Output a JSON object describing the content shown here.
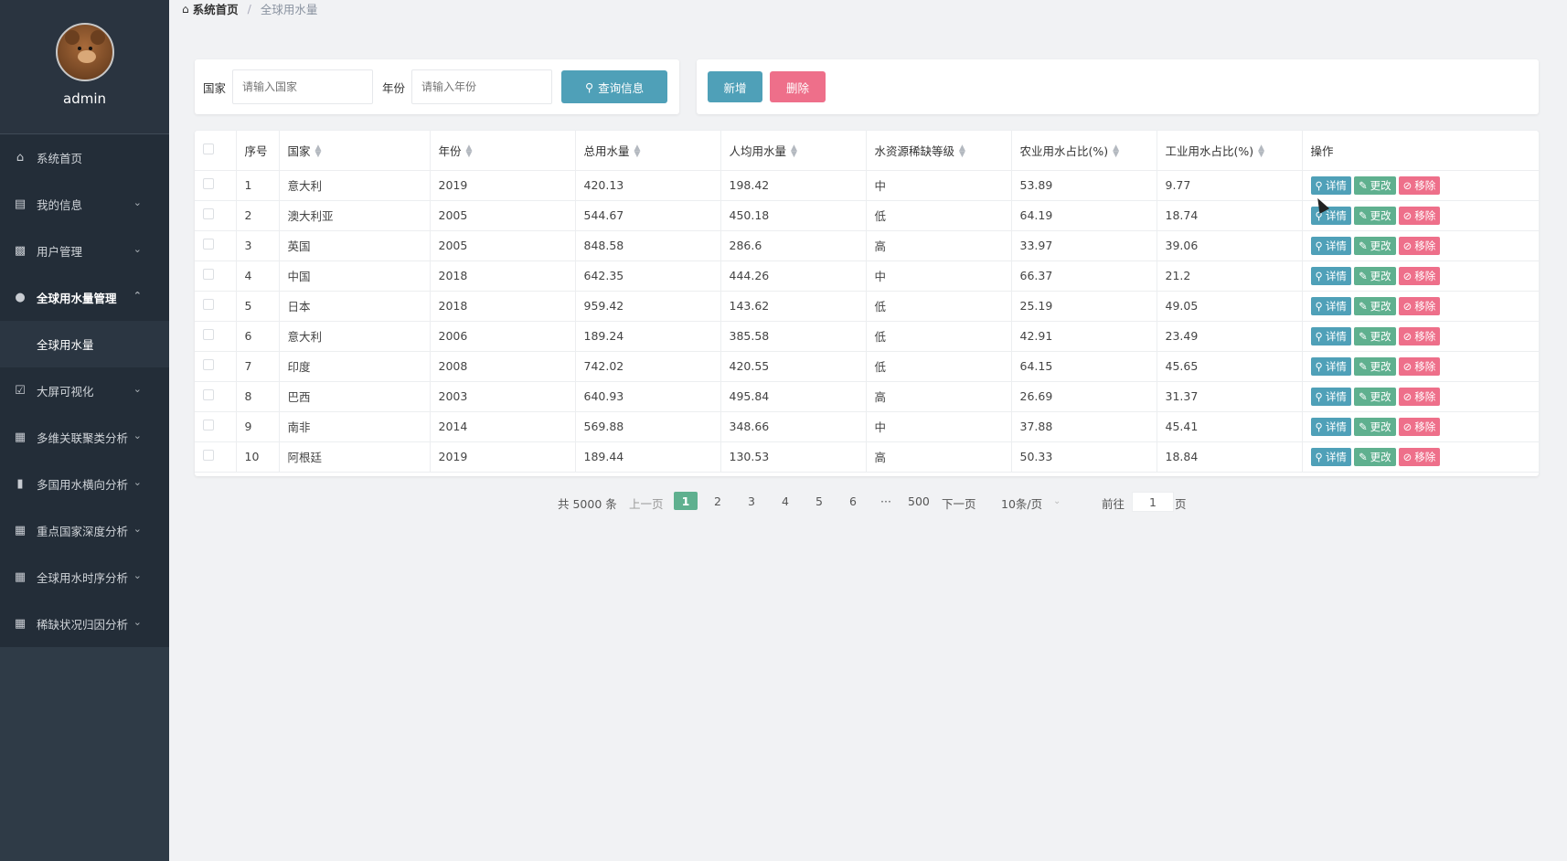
{
  "sidebar": {
    "username": "admin",
    "items": [
      {
        "label": "系统首页",
        "icon": "home-icon",
        "chev": false
      },
      {
        "label": "我的信息",
        "icon": "card-icon",
        "chev": true
      },
      {
        "label": "用户管理",
        "icon": "users-icon",
        "chev": true
      },
      {
        "label": "全球用水量管理",
        "icon": "user-icon",
        "chev": true,
        "expanded": true
      },
      {
        "label": "全球用水量",
        "sub": true
      },
      {
        "label": "大屏可视化",
        "icon": "clipboard-icon",
        "chev": true
      },
      {
        "label": "多维关联聚类分析",
        "icon": "grid-icon",
        "chev": true
      },
      {
        "label": "多国用水横向分析",
        "icon": "chart-icon",
        "chev": true
      },
      {
        "label": "重点国家深度分析",
        "icon": "grid-icon",
        "chev": true
      },
      {
        "label": "全球用水时序分析",
        "icon": "grid-icon",
        "chev": true
      },
      {
        "label": "稀缺状况归因分析",
        "icon": "grid-icon",
        "chev": true
      }
    ]
  },
  "breadcrumb": {
    "home": "系统首页",
    "separator": "/",
    "current": "全球用水量"
  },
  "search": {
    "country_label": "国家",
    "country_placeholder": "请输入国家",
    "year_label": "年份",
    "year_placeholder": "请输入年份",
    "search_button": "查询信息"
  },
  "actions": {
    "add": "新增",
    "delete": "删除"
  },
  "table": {
    "headers": [
      "序号",
      "国家",
      "年份",
      "总用水量",
      "人均用水量",
      "水资源稀缺等级",
      "农业用水占比(%)",
      "工业用水占比(%)",
      "操作"
    ],
    "sortable": [
      false,
      true,
      true,
      true,
      true,
      true,
      true,
      true,
      false
    ],
    "op_labels": {
      "detail": "详情",
      "edit": "更改",
      "remove": "移除"
    },
    "rows": [
      [
        "1",
        "意大利",
        "2019",
        "420.13",
        "198.42",
        "中",
        "53.89",
        "9.77"
      ],
      [
        "2",
        "澳大利亚",
        "2005",
        "544.67",
        "450.18",
        "低",
        "64.19",
        "18.74"
      ],
      [
        "3",
        "英国",
        "2005",
        "848.58",
        "286.6",
        "高",
        "33.97",
        "39.06"
      ],
      [
        "4",
        "中国",
        "2018",
        "642.35",
        "444.26",
        "中",
        "66.37",
        "21.2"
      ],
      [
        "5",
        "日本",
        "2018",
        "959.42",
        "143.62",
        "低",
        "25.19",
        "49.05"
      ],
      [
        "6",
        "意大利",
        "2006",
        "189.24",
        "385.58",
        "低",
        "42.91",
        "23.49"
      ],
      [
        "7",
        "印度",
        "2008",
        "742.02",
        "420.55",
        "低",
        "64.15",
        "45.65"
      ],
      [
        "8",
        "巴西",
        "2003",
        "640.93",
        "495.84",
        "高",
        "26.69",
        "31.37"
      ],
      [
        "9",
        "南非",
        "2014",
        "569.88",
        "348.66",
        "中",
        "37.88",
        "45.41"
      ],
      [
        "10",
        "阿根廷",
        "2019",
        "189.44",
        "130.53",
        "高",
        "50.33",
        "18.84"
      ]
    ]
  },
  "pagination": {
    "total": "共 5000 条",
    "prev": "上一页",
    "pages": [
      "1",
      "2",
      "3",
      "4",
      "5",
      "6"
    ],
    "ellipsis": "···",
    "last": "500",
    "next": "下一页",
    "page_size": "10条/页",
    "goto_label": "前往",
    "goto_value": "1",
    "goto_suffix": "页"
  }
}
